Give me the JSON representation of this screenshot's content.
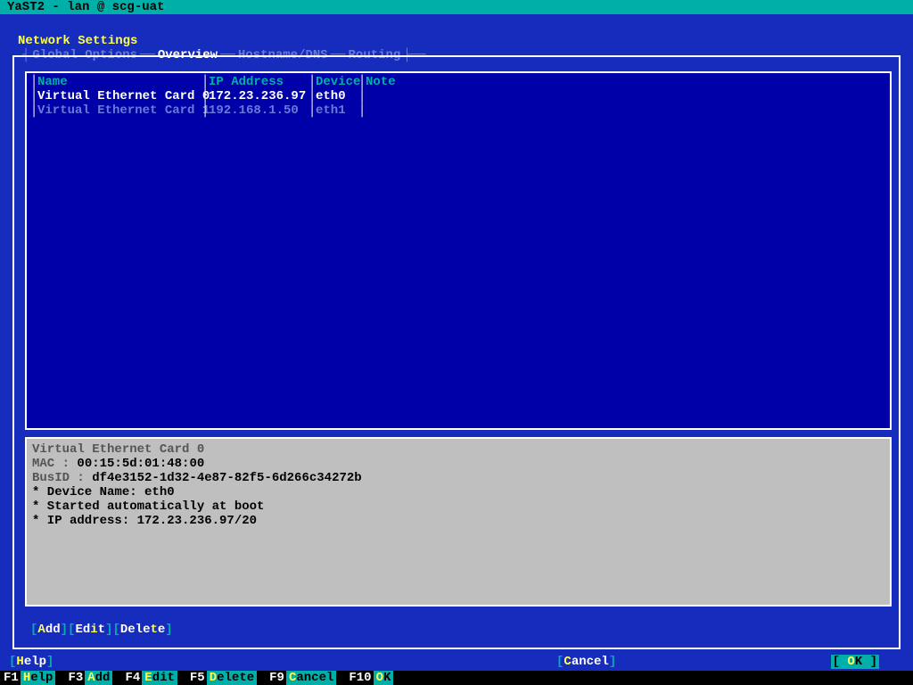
{
  "titlebar": "YaST2 - lan @ scg-uat",
  "page_title": "Network Settings",
  "tabs": {
    "global": "Global Options",
    "overview": "Overview",
    "hostname": "Hostname/DNS",
    "routing": "Routing",
    "active": "Overview"
  },
  "table": {
    "cols": {
      "name": "Name",
      "ip": "IP Address",
      "device": "Device",
      "note": "Note"
    },
    "rows": [
      {
        "name": "Virtual Ethernet Card 0",
        "ip": "172.23.236.97",
        "device": "eth0",
        "note": "",
        "selected": true
      },
      {
        "name": "Virtual Ethernet Card 1",
        "ip": "192.168.1.50",
        "device": "eth1",
        "note": "",
        "selected": false
      }
    ]
  },
  "detail": {
    "title": "Virtual Ethernet Card 0",
    "mac_label": "MAC : ",
    "mac": "00:15:5d:01:48:00",
    "busid_label": "BusID : ",
    "busid": "df4e3152-1d32-4e87-82f5-6d266c34272b",
    "line_device": " *  Device Name: eth0",
    "line_boot": " *  Started automatically at boot",
    "line_ip": " *  IP address: 172.23.236.97/20"
  },
  "buttons": {
    "add_full": "Add",
    "add_h": "A",
    "add_rest": "dd",
    "edit_full": "Edit",
    "edit_pre": "Ed",
    "edit_h": "i",
    "edit_post": "t",
    "delete_full": "Delete",
    "del_pre": "Dele",
    "del_h": "t",
    "del_post": "e",
    "help_h": "H",
    "help_rest": "elp",
    "cancel_h": "C",
    "cancel_rest": "ancel",
    "ok_h": "O",
    "ok_rest": "K"
  },
  "fkeys": [
    {
      "num": "F1",
      "h": "H",
      "rest": "elp"
    },
    {
      "num": "F3",
      "h": "A",
      "rest": "dd"
    },
    {
      "num": "F4",
      "h": "E",
      "rest": "dit"
    },
    {
      "num": "F5",
      "h": "D",
      "rest": "elete"
    },
    {
      "num": "F9",
      "h": "C",
      "rest": "ancel"
    },
    {
      "num": "F10",
      "h": "O",
      "rest": "K"
    }
  ]
}
